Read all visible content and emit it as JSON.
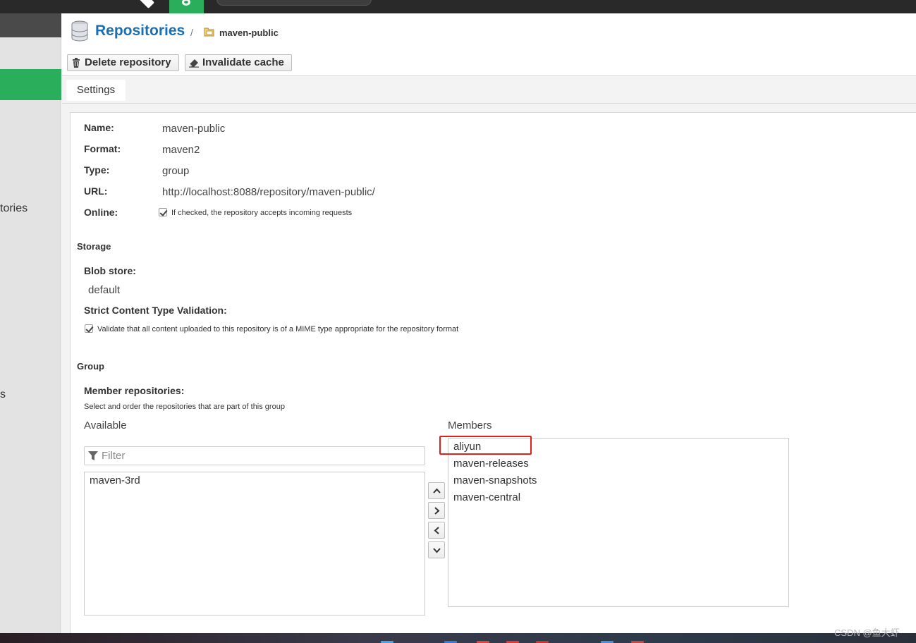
{
  "sidebar": {
    "items": [
      {
        "label": "tories"
      },
      {
        "label": "s"
      }
    ]
  },
  "header": {
    "title": "Repositories",
    "separator": "/",
    "repository_name": "maven-public",
    "title_icon": "database-icon",
    "crumb_icon": "folder-repo-icon"
  },
  "toolbar": {
    "delete_label": "Delete repository",
    "delete_icon": "trash-icon",
    "invalidate_label": "Invalidate cache",
    "invalidate_icon": "eraser-icon"
  },
  "tabs": [
    {
      "label": "Settings",
      "active": true
    }
  ],
  "settings": {
    "name_label": "Name:",
    "name_value": "maven-public",
    "format_label": "Format:",
    "format_value": "maven2",
    "type_label": "Type:",
    "type_value": "group",
    "url_label": "URL:",
    "url_value": "http://localhost:8088/repository/maven-public/",
    "online_label": "Online:",
    "online_checked": true,
    "online_help": "If checked, the repository accepts incoming requests"
  },
  "storage": {
    "section_title": "Storage",
    "blob_label": "Blob store:",
    "blob_value": "default",
    "strict_label": "Strict Content Type Validation:",
    "strict_checked": true,
    "strict_help": "Validate that all content uploaded to this repository is of a MIME type appropriate for the repository format"
  },
  "group": {
    "section_title": "Group",
    "members_label": "Member repositories:",
    "members_help": "Select and order the repositories that are part of this group",
    "available_title": "Available",
    "filter_placeholder": "Filter",
    "available_items": [
      "maven-3rd"
    ],
    "members_title": "Members",
    "member_items": [
      "aliyun",
      "maven-releases",
      "maven-snapshots",
      "maven-central"
    ],
    "highlighted_member": "aliyun",
    "arrow_buttons": [
      "chevron-up-icon",
      "chevron-right-icon",
      "chevron-left-icon",
      "chevron-down-icon"
    ]
  },
  "watermark": "CSDN @鱼大虾",
  "colors": {
    "accent_green": "#2aae5c",
    "title_blue": "#1a6fb3",
    "highlight_red": "#e0201b",
    "topbar": "#292929"
  }
}
